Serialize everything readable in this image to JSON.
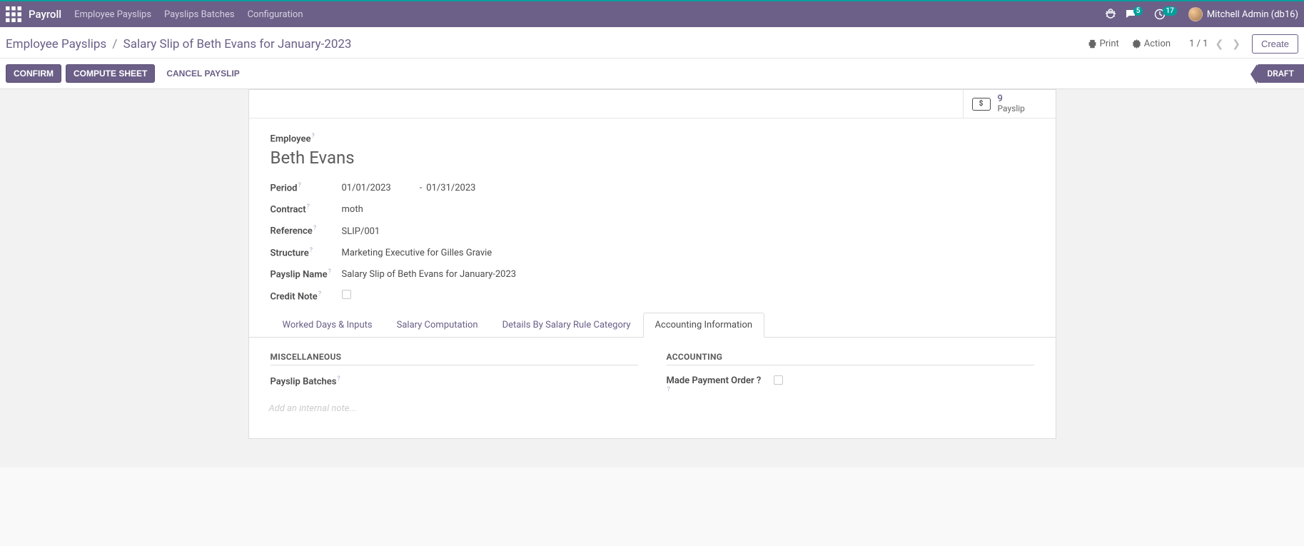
{
  "navbar": {
    "app_name": "Payroll",
    "links": [
      "Employee Payslips",
      "Payslips Batches",
      "Configuration"
    ],
    "chat_badge": "5",
    "clock_badge": "17",
    "user": "Mitchell Admin (db16)"
  },
  "titlebar": {
    "breadcrumb_parent": "Employee Payslips",
    "breadcrumb_current": "Salary Slip of Beth Evans for January-2023",
    "print": "Print",
    "action": "Action",
    "pager": "1 / 1",
    "create": "Create"
  },
  "btnbar": {
    "confirm": "Confirm",
    "compute": "Compute Sheet",
    "cancel": "Cancel Payslip",
    "status": "Draft"
  },
  "stat": {
    "value": "9",
    "label": "Payslip"
  },
  "form": {
    "employee_label": "Employee",
    "employee_value": "Beth Evans",
    "period_label": "Period",
    "period_from": "01/01/2023",
    "period_to": "01/31/2023",
    "contract_label": "Contract",
    "contract_value": "moth",
    "reference_label": "Reference",
    "reference_value": "SLIP/001",
    "structure_label": "Structure",
    "structure_value": "Marketing Executive for Gilles Gravie",
    "payslip_name_label": "Payslip Name",
    "payslip_name_value": "Salary Slip of Beth Evans for January-2023",
    "credit_note_label": "Credit Note"
  },
  "tabs": {
    "worked": "Worked Days & Inputs",
    "salary": "Salary Computation",
    "details": "Details By Salary Rule Category",
    "accounting": "Accounting Information"
  },
  "sections": {
    "misc_title": "Miscellaneous",
    "payslip_batches_label": "Payslip Batches",
    "accounting_title": "Accounting",
    "made_payment_label": "Made Payment Order ?",
    "internal_note_placeholder": "Add an internal note..."
  }
}
